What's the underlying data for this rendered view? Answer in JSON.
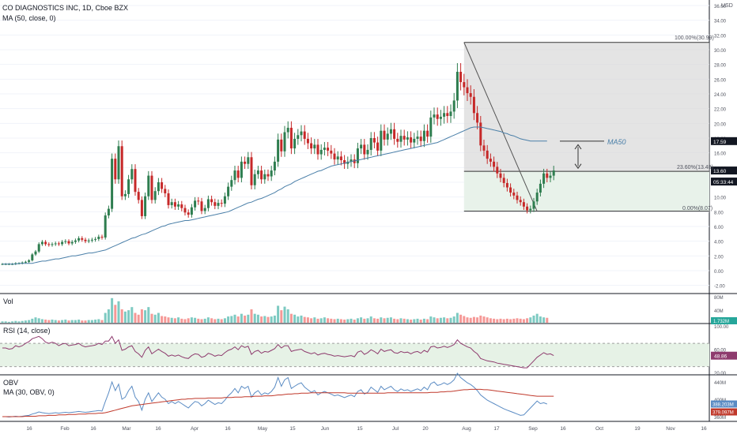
{
  "colors": {
    "up": "#26a69a",
    "down": "#ef5350",
    "candle_up": "#2e7d4f",
    "candle_down": "#c62828",
    "ma": "#4a7fa8",
    "rsi": "#8e3b6e",
    "obv": "#5b8cc4",
    "obv_ma": "#c0392b",
    "fib_upper": "#d6d6d6",
    "fib_lower": "#e8f2ea",
    "badge": "#131722"
  },
  "header": {
    "title": "CO DIAGNOSTICS INC, 1D, Cboe BZX",
    "ma_label": "MA (50, close, 0)"
  },
  "panes": {
    "vol_label": "Vol",
    "rsi_label": "RSI (14, close)",
    "obv_label": "OBV",
    "obv_ma_label": "MA (30, OBV, 0)"
  },
  "price_axis": {
    "currency": "USD",
    "ticks": [
      "36.00",
      "34.00",
      "32.00",
      "30.00",
      "28.00",
      "26.00",
      "24.00",
      "22.00",
      "20.00",
      "18.00",
      "16.00",
      "14.00",
      "12.00",
      "10.00",
      "8.00",
      "6.00",
      "4.00",
      "2.00",
      "0.00",
      "-2.00"
    ],
    "tick_values": [
      36,
      34,
      32,
      30,
      28,
      26,
      24,
      22,
      20,
      18,
      16,
      14,
      12,
      10,
      8,
      6,
      4,
      2,
      0,
      -2
    ],
    "badges": [
      {
        "text": "17.59",
        "value": 17.59
      },
      {
        "text": "13.60",
        "value": 13.6
      },
      {
        "text": "05:33:44",
        "value": 12.1
      }
    ]
  },
  "vol_axis": {
    "ticks": [
      "80M",
      "40M"
    ],
    "badge": "1.732M"
  },
  "rsi_axis": {
    "ticks": [
      "100.00",
      "60.00",
      "20.00"
    ],
    "badge": "48.86"
  },
  "obv_axis": {
    "ticks": [
      "440M",
      "400M",
      "360M"
    ],
    "badge_obv": "388.203M",
    "badge_ma": "379.097M"
  },
  "time_axis": {
    "labels": [
      "16",
      "Feb",
      "16",
      "Mar",
      "16",
      "Apr",
      "16",
      "May",
      "15",
      "Jun",
      "15",
      "Jul",
      "20",
      "Aug",
      "17",
      "Sep",
      "16",
      "Oct",
      "19",
      "Nov",
      "16"
    ]
  },
  "fib": {
    "label_top": "100.00%(30.99)",
    "label_mid": "23.60%(13.48)",
    "label_bottom": "0.00%(8.07)",
    "top": 30.99,
    "mid": 13.48,
    "bottom": 8.07
  },
  "annotation": {
    "ma50": "MA50"
  },
  "chart_data": {
    "type": "candlestick",
    "title": "CO DIAGNOSTICS INC, 1D, Cboe BZX",
    "ylabel": "USD",
    "ylim": [
      -3,
      37
    ],
    "close": [
      0.9,
      0.9,
      0.9,
      0.9,
      1.0,
      1.0,
      1.1,
      1.2,
      1.4,
      2.2,
      2.6,
      3.6,
      3.9,
      3.6,
      3.5,
      3.6,
      3.7,
      3.6,
      3.9,
      4.0,
      3.7,
      3.9,
      4.1,
      4.4,
      4.2,
      4.0,
      4.1,
      4.2,
      4.3,
      4.6,
      4.5,
      7.5,
      8.4,
      15.2,
      12.4,
      16.9,
      10.1,
      10.4,
      12.4,
      13.8,
      10.7,
      9.6,
      7.4,
      10.1,
      12.9,
      9.6,
      10.8,
      12.0,
      11.1,
      10.5,
      8.9,
      9.3,
      8.7,
      9.0,
      8.5,
      7.9,
      7.6,
      8.6,
      9.5,
      9.4,
      8.1,
      8.5,
      9.7,
      9.3,
      8.8,
      9.2,
      9.1,
      10.1,
      11.4,
      12.3,
      13.6,
      12.6,
      14.8,
      14.5,
      15.4,
      11.6,
      13.1,
      13.6,
      12.4,
      13.1,
      12.8,
      13.6,
      14.8,
      17.8,
      16.2,
      18.8,
      19.4,
      16.6,
      17.9,
      18.4,
      18.9,
      17.9,
      17.3,
      16.6,
      17.1,
      15.8,
      16.4,
      16.7,
      16.3,
      15.9,
      15.1,
      15.5,
      15.0,
      14.5,
      14.8,
      15.1,
      14.6,
      16.6,
      17.1,
      15.8,
      16.4,
      18.0,
      17.4,
      16.3,
      19.0,
      17.8,
      18.6,
      19.2,
      17.9,
      17.5,
      18.3,
      17.8,
      18.1,
      17.4,
      17.9,
      18.2,
      17.6,
      19.0,
      18.2,
      20.8,
      21.2,
      20.6,
      20.9,
      21.4,
      21.0,
      21.6,
      23.1,
      27.0,
      25.6,
      24.9,
      24.1,
      23.6,
      21.4,
      20.1,
      17.0,
      16.3,
      15.2,
      14.8,
      14.1,
      13.2,
      12.6,
      11.9,
      11.3,
      10.6,
      10.2,
      9.6,
      9.3,
      8.7,
      8.2,
      8.4,
      9.4,
      10.6,
      11.8,
      13.2,
      12.6,
      12.9,
      13.6
    ],
    "ma50": [
      0.9,
      0.9,
      0.9,
      0.9,
      0.9,
      1.0,
      1.0,
      1.0,
      1.0,
      1.0,
      1.1,
      1.2,
      1.3,
      1.3,
      1.4,
      1.5,
      1.6,
      1.6,
      1.7,
      1.8,
      1.9,
      2.0,
      2.0,
      2.1,
      2.2,
      2.3,
      2.4,
      2.4,
      2.5,
      2.6,
      2.7,
      2.8,
      3.0,
      3.2,
      3.4,
      3.6,
      3.8,
      4.0,
      4.2,
      4.4,
      4.5,
      4.7,
      4.9,
      5.0,
      5.2,
      5.4,
      5.6,
      5.8,
      6.0,
      6.1,
      6.3,
      6.4,
      6.5,
      6.6,
      6.7,
      6.8,
      6.8,
      6.9,
      7.0,
      7.1,
      7.2,
      7.3,
      7.4,
      7.5,
      7.6,
      7.7,
      7.8,
      7.9,
      8.0,
      8.2,
      8.4,
      8.6,
      8.8,
      9.0,
      9.2,
      9.3,
      9.5,
      9.7,
      9.8,
      10.0,
      10.2,
      10.4,
      10.6,
      10.9,
      11.1,
      11.4,
      11.6,
      11.8,
      12.1,
      12.3,
      12.5,
      12.7,
      12.9,
      13.1,
      13.3,
      13.5,
      13.6,
      13.8,
      14.0,
      14.2,
      14.3,
      14.4,
      14.5,
      14.6,
      14.7,
      14.8,
      14.9,
      15.0,
      15.1,
      15.2,
      15.3,
      15.4,
      15.5,
      15.6,
      15.7,
      15.8,
      15.9,
      16.0,
      16.1,
      16.2,
      16.3,
      16.4,
      16.5,
      16.6,
      16.7,
      16.8,
      16.9,
      17.0,
      17.1,
      17.2,
      17.3,
      17.4,
      17.6,
      17.8,
      18.0,
      18.2,
      18.4,
      18.6,
      18.8,
      19.0,
      19.2,
      19.4,
      19.5,
      19.5,
      19.5,
      19.4,
      19.3,
      19.2,
      19.1,
      19.0,
      18.9,
      18.7,
      18.6,
      18.4,
      18.3,
      18.1,
      17.9,
      17.8,
      17.7,
      17.6,
      17.6,
      17.6,
      17.6,
      17.6,
      17.6
    ],
    "volume": [
      3,
      3,
      2,
      3,
      4,
      3,
      4,
      5,
      6,
      9,
      12,
      10,
      8,
      7,
      6,
      7,
      6,
      5,
      6,
      7,
      5,
      6,
      6,
      7,
      5,
      5,
      6,
      6,
      7,
      8,
      6,
      22,
      30,
      55,
      40,
      48,
      30,
      25,
      28,
      35,
      22,
      18,
      30,
      28,
      35,
      20,
      18,
      22,
      15,
      14,
      12,
      11,
      10,
      12,
      9,
      8,
      10,
      12,
      11,
      9,
      8,
      9,
      12,
      10,
      8,
      9,
      8,
      10,
      14,
      15,
      18,
      14,
      20,
      16,
      18,
      30,
      20,
      18,
      14,
      15,
      13,
      14,
      16,
      38,
      28,
      36,
      30,
      20,
      18,
      14,
      16,
      13,
      12,
      10,
      12,
      9,
      10,
      12,
      10,
      9,
      8,
      9,
      8,
      7,
      8,
      9,
      7,
      10,
      12,
      9,
      10,
      14,
      10,
      9,
      12,
      10,
      11,
      12,
      9,
      8,
      10,
      9,
      8,
      7,
      8,
      9,
      7,
      9,
      8,
      14,
      12,
      10,
      11,
      12,
      10,
      11,
      14,
      22,
      18,
      15,
      12,
      11,
      13,
      12,
      16,
      14,
      12,
      10,
      9,
      8,
      9,
      8,
      9,
      8,
      9,
      10,
      9,
      8,
      10,
      12,
      16,
      20,
      14,
      12,
      11
    ],
    "rsi": [
      62,
      62,
      60,
      61,
      66,
      64,
      66,
      70,
      73,
      78,
      80,
      82,
      78,
      72,
      70,
      72,
      70,
      66,
      69,
      70,
      66,
      67,
      68,
      70,
      66,
      64,
      65,
      66,
      67,
      70,
      68,
      74,
      74,
      82,
      70,
      76,
      58,
      60,
      64,
      66,
      56,
      52,
      46,
      58,
      64,
      52,
      56,
      60,
      56,
      53,
      48,
      50,
      48,
      50,
      47,
      45,
      44,
      49,
      52,
      51,
      46,
      48,
      53,
      51,
      48,
      50,
      49,
      54,
      58,
      60,
      64,
      59,
      66,
      63,
      65,
      51,
      56,
      58,
      53,
      56,
      55,
      58,
      61,
      68,
      62,
      66,
      66,
      56,
      58,
      59,
      60,
      56,
      54,
      52,
      54,
      50,
      52,
      53,
      51,
      50,
      48,
      49,
      48,
      47,
      48,
      49,
      47,
      55,
      57,
      51,
      54,
      59,
      56,
      52,
      60,
      56,
      58,
      59,
      54,
      53,
      56,
      54,
      55,
      52,
      55,
      56,
      53,
      58,
      55,
      64,
      65,
      62,
      63,
      65,
      63,
      65,
      68,
      76,
      70,
      67,
      64,
      62,
      56,
      52,
      44,
      42,
      40,
      39,
      38,
      36,
      35,
      34,
      33,
      32,
      31,
      30,
      29,
      28,
      28,
      34,
      40,
      46,
      50,
      54,
      51,
      52,
      49
    ],
    "obv": [
      360,
      360,
      359,
      360,
      361,
      360,
      361,
      362,
      363,
      366,
      368,
      371,
      369,
      368,
      367,
      368,
      369,
      368,
      369,
      370,
      369,
      370,
      371,
      372,
      371,
      370,
      371,
      372,
      373,
      374,
      373,
      395,
      415,
      440,
      420,
      435,
      400,
      405,
      420,
      430,
      405,
      395,
      375,
      400,
      415,
      395,
      405,
      415,
      405,
      400,
      390,
      395,
      390,
      395,
      390,
      385,
      380,
      388,
      395,
      393,
      385,
      390,
      398,
      393,
      388,
      392,
      390,
      398,
      408,
      415,
      425,
      415,
      430,
      425,
      430,
      405,
      415,
      420,
      410,
      415,
      412,
      418,
      428,
      450,
      430,
      445,
      450,
      425,
      430,
      435,
      438,
      428,
      422,
      416,
      420,
      410,
      415,
      418,
      415,
      412,
      408,
      410,
      407,
      404,
      407,
      410,
      406,
      418,
      422,
      412,
      416,
      428,
      422,
      416,
      430,
      422,
      426,
      430,
      422,
      418,
      424,
      420,
      422,
      418,
      421,
      424,
      420,
      428,
      422,
      436,
      440,
      432,
      434,
      438,
      434,
      438,
      445,
      460,
      450,
      444,
      438,
      434,
      428,
      420,
      410,
      404,
      398,
      394,
      390,
      386,
      382,
      378,
      375,
      372,
      369,
      366,
      363,
      364,
      372,
      380,
      388,
      396,
      390,
      392,
      389
    ],
    "obv_ma": [
      360,
      360,
      360,
      360,
      360,
      360,
      360,
      361,
      361,
      361,
      361,
      362,
      362,
      362,
      363,
      363,
      363,
      364,
      364,
      364,
      365,
      365,
      365,
      366,
      366,
      366,
      367,
      367,
      367,
      368,
      368,
      369,
      371,
      373,
      375,
      377,
      379,
      381,
      383,
      385,
      386,
      387,
      388,
      389,
      390,
      391,
      392,
      393,
      394,
      395,
      396,
      397,
      398,
      399,
      400,
      400,
      401,
      401,
      402,
      402,
      402,
      402,
      403,
      403,
      403,
      403,
      403,
      404,
      404,
      404,
      405,
      405,
      405,
      406,
      406,
      406,
      407,
      407,
      407,
      408,
      408,
      408,
      409,
      410,
      410,
      411,
      412,
      412,
      413,
      413,
      414,
      414,
      414,
      415,
      415,
      415,
      415,
      415,
      415,
      415,
      415,
      415,
      415,
      415,
      414,
      414,
      414,
      414,
      414,
      414,
      414,
      414,
      414,
      414,
      414,
      414,
      415,
      415,
      415,
      415,
      415,
      415,
      415,
      415,
      415,
      415,
      415,
      415,
      415,
      416,
      416,
      416,
      417,
      417,
      418,
      418,
      419,
      420,
      421,
      422,
      422,
      423,
      423,
      423,
      423,
      422,
      422,
      421,
      420,
      419,
      418,
      417,
      416,
      415,
      414,
      413,
      412,
      411,
      410,
      409,
      408,
      407,
      407,
      407,
      407,
      407,
      407
    ]
  }
}
